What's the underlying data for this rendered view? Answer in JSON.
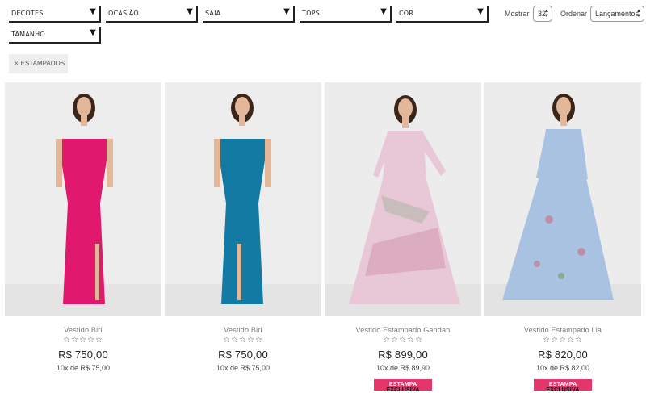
{
  "filters": {
    "decotes": "DECOTES",
    "ocasiao": "OCASIÃO",
    "saia": "SAIA",
    "tops": "TOPS",
    "cor": "COR",
    "tamanho": "TAMANHO",
    "arrow_icon": "triangle-down"
  },
  "controls": {
    "show_label": "Mostrar",
    "show_value": "32",
    "sort_label": "Ordenar",
    "sort_value": "Lançamentos"
  },
  "active_filter": {
    "remove_icon": "×",
    "label": "ESTAMPADOS"
  },
  "products": [
    {
      "name": "Vestido Biri",
      "stars": "☆☆☆☆☆",
      "price": "R$ 750,00",
      "installments": "10x de R$ 75,00",
      "dress_color": "#e0196e",
      "badge": null
    },
    {
      "name": "Vestido Biri",
      "stars": "☆☆☆☆☆",
      "price": "R$ 750,00",
      "installments": "10x de R$ 75,00",
      "dress_color": "#127aa3",
      "badge": null
    },
    {
      "name": "Vestido Estampado Gandan",
      "stars": "☆☆☆☆☆",
      "price": "R$ 899,00",
      "installments": "10x de R$ 89,90",
      "dress_color": "#e8c8d6",
      "badge": {
        "part1": "ESTAMPA",
        "part2": "EXCLUSIVA"
      }
    },
    {
      "name": "Vestido Estampado Lia",
      "stars": "☆☆☆☆☆",
      "price": "R$ 820,00",
      "installments": "10x de R$ 82,00",
      "dress_color": "#a9c2e2",
      "badge": {
        "part1": "ESTAMPA",
        "part2": "EXCLUSIVA"
      }
    }
  ],
  "colors": {
    "badge_bg": "#e6356b",
    "photo_bg": "#ededed"
  }
}
